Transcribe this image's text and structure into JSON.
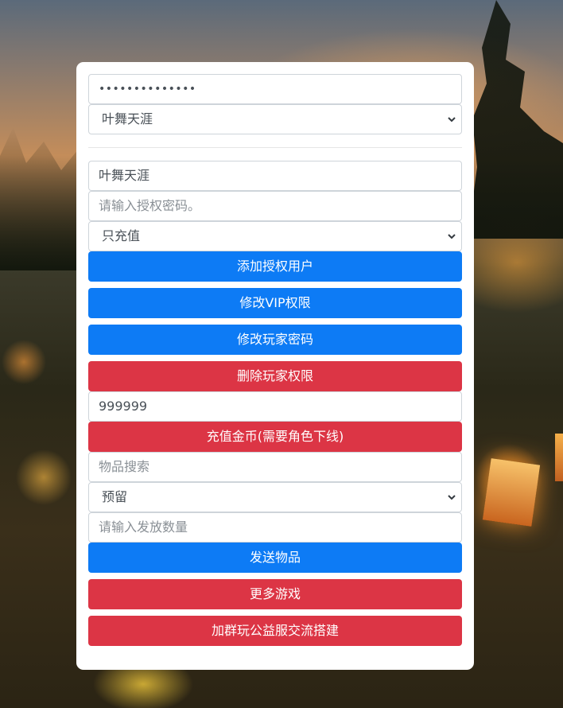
{
  "top": {
    "password_value": "••••••••••••••",
    "server_select_value": "叶舞天涯"
  },
  "auth": {
    "username_value": "叶舞天涯",
    "auth_password_placeholder": "请输入授权密码。",
    "permission_select_value": "只充值",
    "add_auth_user_label": "添加授权用户",
    "modify_vip_label": "修改VIP权限",
    "modify_player_password_label": "修改玩家密码",
    "delete_player_permission_label": "删除玩家权限"
  },
  "gold": {
    "amount_value": "999999",
    "recharge_label": "充值金币(需要角色下线)"
  },
  "items": {
    "search_placeholder": "物品搜索",
    "item_select_value": "预留",
    "quantity_placeholder": "请输入发放数量",
    "send_label": "发送物品"
  },
  "footer": {
    "more_games_label": "更多游戏",
    "join_group_label": "加群玩公益服交流搭建"
  },
  "colors": {
    "primary": "#0d7bf5",
    "danger": "#dc3545"
  },
  "icons": {
    "select_chevron": "chevron-down-icon"
  }
}
